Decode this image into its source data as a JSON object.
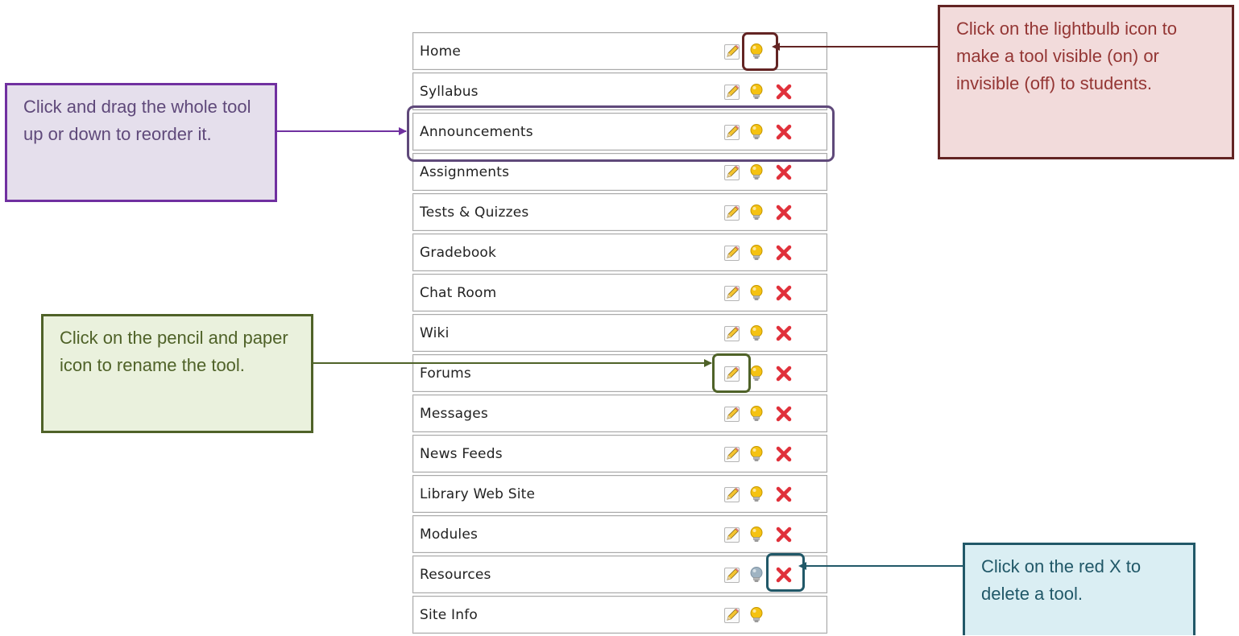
{
  "tools": [
    {
      "name": "Home",
      "visible": true,
      "deletable": false
    },
    {
      "name": "Syllabus",
      "visible": true,
      "deletable": true
    },
    {
      "name": "Announcements",
      "visible": true,
      "deletable": true
    },
    {
      "name": "Assignments",
      "visible": true,
      "deletable": true
    },
    {
      "name": "Tests & Quizzes",
      "visible": true,
      "deletable": true
    },
    {
      "name": "Gradebook",
      "visible": true,
      "deletable": true
    },
    {
      "name": "Chat Room",
      "visible": true,
      "deletable": true
    },
    {
      "name": "Wiki",
      "visible": true,
      "deletable": true
    },
    {
      "name": "Forums",
      "visible": true,
      "deletable": true
    },
    {
      "name": "Messages",
      "visible": true,
      "deletable": true
    },
    {
      "name": "News Feeds",
      "visible": true,
      "deletable": true
    },
    {
      "name": "Library Web Site",
      "visible": true,
      "deletable": true
    },
    {
      "name": "Modules",
      "visible": true,
      "deletable": true
    },
    {
      "name": "Resources",
      "visible": false,
      "deletable": true
    },
    {
      "name": "Site Info",
      "visible": true,
      "deletable": false
    }
  ],
  "callouts": {
    "reorder": "Click and drag the whole tool up or down to reorder it.",
    "visibility": "Click on the lightbulb icon to make a tool visible (on) or invisible (off) to students.",
    "rename": "Click on the pencil and paper icon to rename the tool.",
    "delete": "Click on the red X to delete a tool."
  },
  "icons": {
    "edit": "pencil-paper-icon",
    "visibility": "lightbulb-icon",
    "delete": "red-x-icon"
  },
  "colors": {
    "purple_accent": "#7030a0",
    "red_accent": "#632423",
    "green_accent": "#4f6228",
    "blue_accent": "#215868",
    "delete_red": "#e0313b",
    "bulb_on": "#f5c211",
    "bulb_off": "#9fb3c2"
  }
}
